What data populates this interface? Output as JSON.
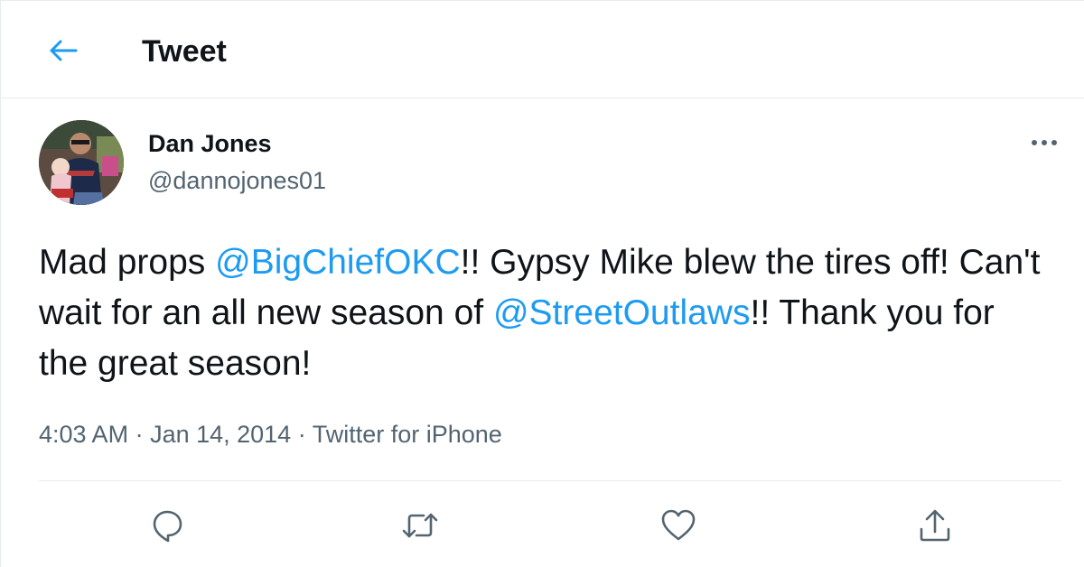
{
  "header": {
    "title": "Tweet"
  },
  "tweet": {
    "author": {
      "display_name": "Dan Jones",
      "handle": "@dannojones01"
    },
    "text": {
      "part1": "Mad props ",
      "mention1": "@BigChiefOKC",
      "part2": "!! Gypsy Mike blew the tires off! Can't wait for an all new season of ",
      "mention2": "@StreetOutlaws",
      "part3": "!! Thank you for the great season!"
    },
    "time": "4:03 AM",
    "separator": " · ",
    "date": "Jan 14, 2014",
    "source": "Twitter for iPhone"
  },
  "icons": {
    "back": "arrow-left-icon",
    "more": "more-horizontal-icon",
    "reply": "reply-icon",
    "retweet": "retweet-icon",
    "like": "heart-icon",
    "share": "share-icon"
  },
  "colors": {
    "accent": "#1d9bf0",
    "text": "#0f1419",
    "secondary": "#536471",
    "border": "#e6ecf0"
  }
}
